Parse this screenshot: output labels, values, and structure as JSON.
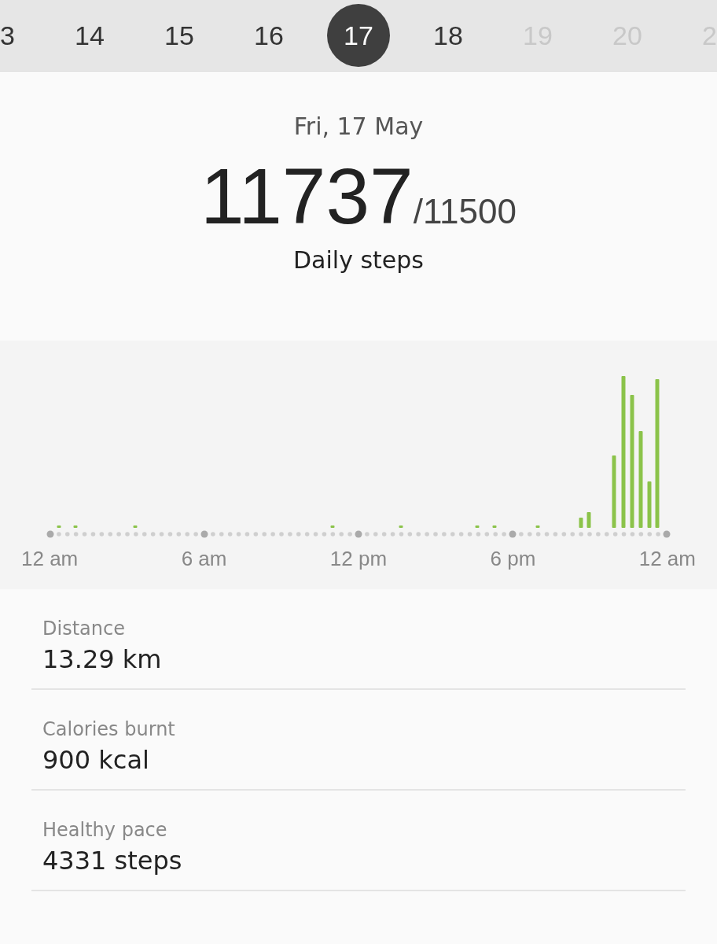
{
  "date_strip": [
    {
      "label": "3",
      "selected": false,
      "disabled": false
    },
    {
      "label": "14",
      "selected": false,
      "disabled": false
    },
    {
      "label": "15",
      "selected": false,
      "disabled": false
    },
    {
      "label": "16",
      "selected": false,
      "disabled": false
    },
    {
      "label": "17",
      "selected": true,
      "disabled": false
    },
    {
      "label": "18",
      "selected": false,
      "disabled": false
    },
    {
      "label": "19",
      "selected": false,
      "disabled": true
    },
    {
      "label": "20",
      "selected": false,
      "disabled": true
    },
    {
      "label": "2",
      "selected": false,
      "disabled": true
    }
  ],
  "summary": {
    "date": "Fri, 17 May",
    "steps": "11737",
    "goal": "/11500",
    "caption": "Daily steps"
  },
  "chart": {
    "axis_labels": [
      "12 am",
      "6 am",
      "12 pm",
      "6 pm",
      "12 am"
    ]
  },
  "stats": [
    {
      "label": "Distance",
      "value": "13.29 km"
    },
    {
      "label": "Calories burnt",
      "value": "900 kcal"
    },
    {
      "label": "Healthy pace",
      "value": "4331 steps"
    }
  ]
}
